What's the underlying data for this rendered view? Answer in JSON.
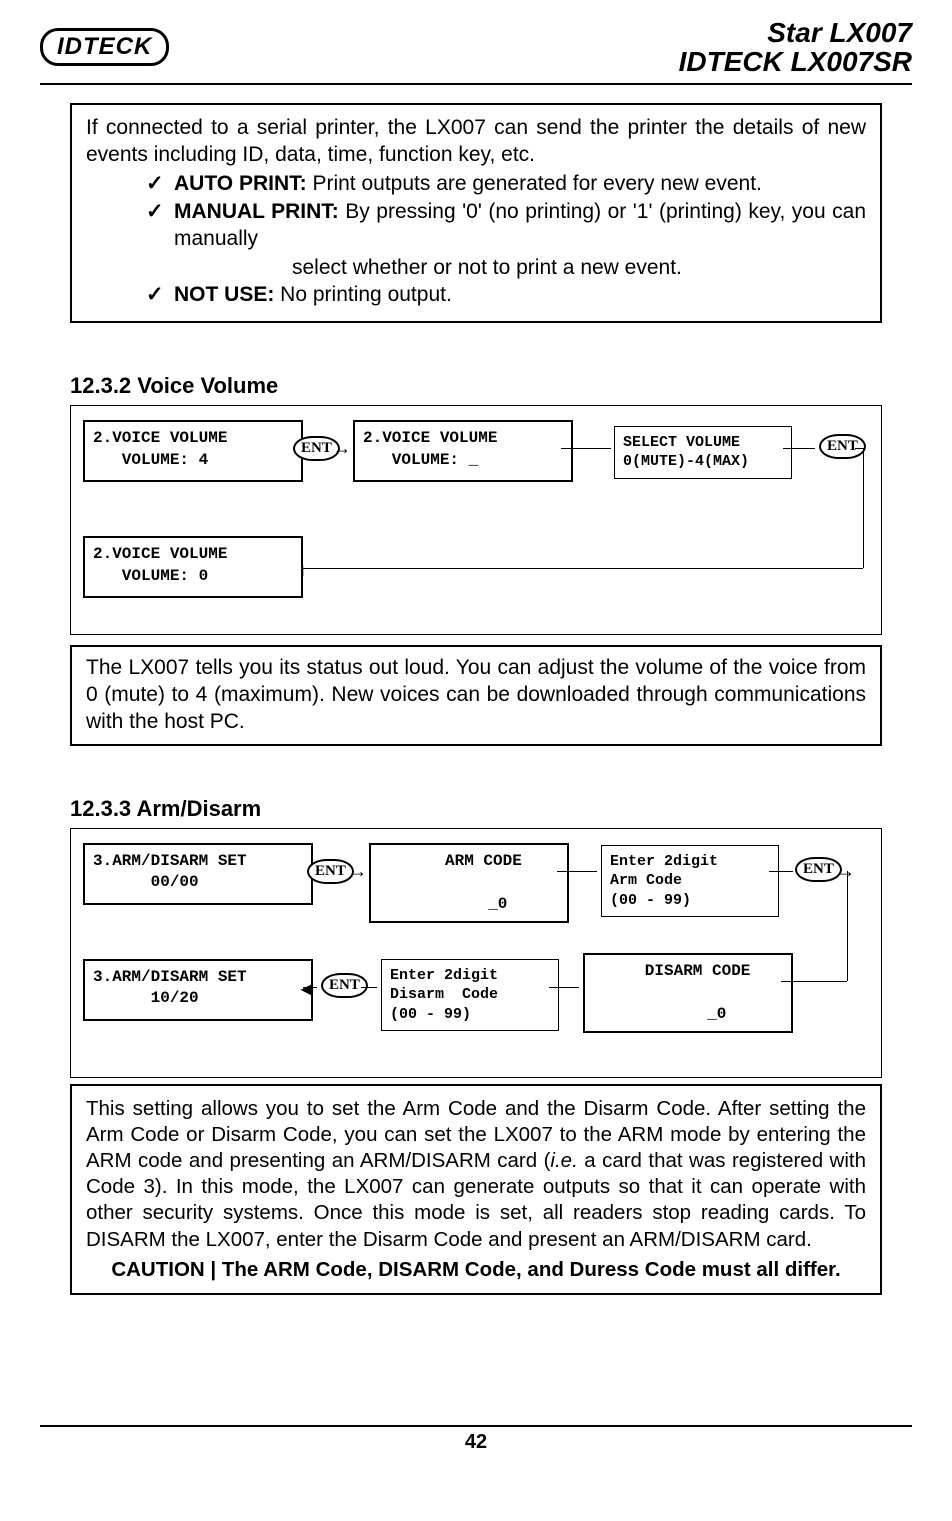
{
  "header": {
    "logo_left": "IDTECK",
    "logo_right_line1_a": "Star",
    "logo_right_line1_b": " LX007",
    "logo_right_line2_a": "IDTECK",
    "logo_right_line2_b": " LX007SR"
  },
  "box_printer": {
    "intro": "If connected to a serial printer, the LX007 can send the printer the details of new events including ID, data, time, function key, etc.",
    "items": [
      {
        "tick": "✓",
        "label": "AUTO PRINT:",
        "desc": " Print outputs are generated for every new event."
      },
      {
        "tick": "✓",
        "label": "MANUAL PRINT:",
        "desc": " By pressing '0' (no printing) or '1' (printing) key, you can manually",
        "cont": "select whether or not to print a new event."
      },
      {
        "tick": "✓",
        "label": "NOT USE:",
        "desc": " No printing output."
      }
    ]
  },
  "section_voice": {
    "title": "12.3.2 Voice Volume",
    "lcd1": "2.VOICE VOLUME\n   VOLUME: 4",
    "lcd2": "2.VOICE VOLUME\n   VOLUME: _",
    "msg": "SELECT VOLUME\n0(MUTE)-4(MAX)",
    "lcd3": "2.VOICE VOLUME\n   VOLUME: 0",
    "box": "The LX007 tells you its status out loud. You can adjust the volume of the voice from 0 (mute) to 4 (maximum). New voices can be downloaded through communications with the host PC."
  },
  "section_arm": {
    "title": "12.3.3 Arm/Disarm",
    "lcd1": "3.ARM/DISARM SET\n      00/00",
    "lcd2": "   ARM CODE\n\n      _0",
    "msg1": "Enter 2digit\nArm Code\n(00 - 99)",
    "lcd3": "3.ARM/DISARM SET\n      10/20",
    "msg2": "Enter 2digit\nDisarm  Code\n(00 - 99)",
    "lcd4": "  DISARM CODE\n\n      _0",
    "box_a": "This setting allows you to set the Arm Code and the Disarm Code. After setting the Arm Code or Disarm Code, you can set the LX007 to the ARM mode by entering the ARM code and presenting an ARM/DISARM card (",
    "box_ie": "i.e.",
    "box_b": " a card that was registered with Code 3). In this mode, the LX007 can generate outputs so that it can operate with other security systems. Once this mode is set, all readers stop reading cards. To DISARM the LX007, enter the Disarm Code and present an ARM/DISARM card.",
    "caution": "CAUTION | The ARM Code, DISARM Code, and Duress Code must all differ."
  },
  "ent_label": "ENT",
  "arrows": {
    "right": "→",
    "left": "◄"
  },
  "page_number": "42"
}
